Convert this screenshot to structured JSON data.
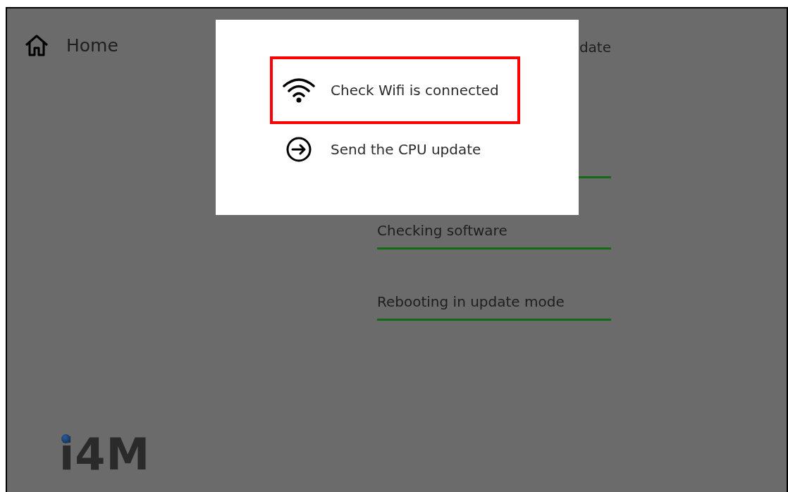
{
  "header": {
    "label": "Home"
  },
  "update_panel": {
    "title_visible_part": "date",
    "steps": [
      {
        "label": "Checking software",
        "done": true
      },
      {
        "label": "Rebooting in update mode",
        "done": true
      }
    ]
  },
  "logo": {
    "text": "i4M"
  },
  "dialog": {
    "items": [
      {
        "kind": "wifi",
        "label": "Check Wifi is connected",
        "highlighted": true
      },
      {
        "kind": "send",
        "label": "Send the CPU update",
        "highlighted": false
      }
    ]
  }
}
